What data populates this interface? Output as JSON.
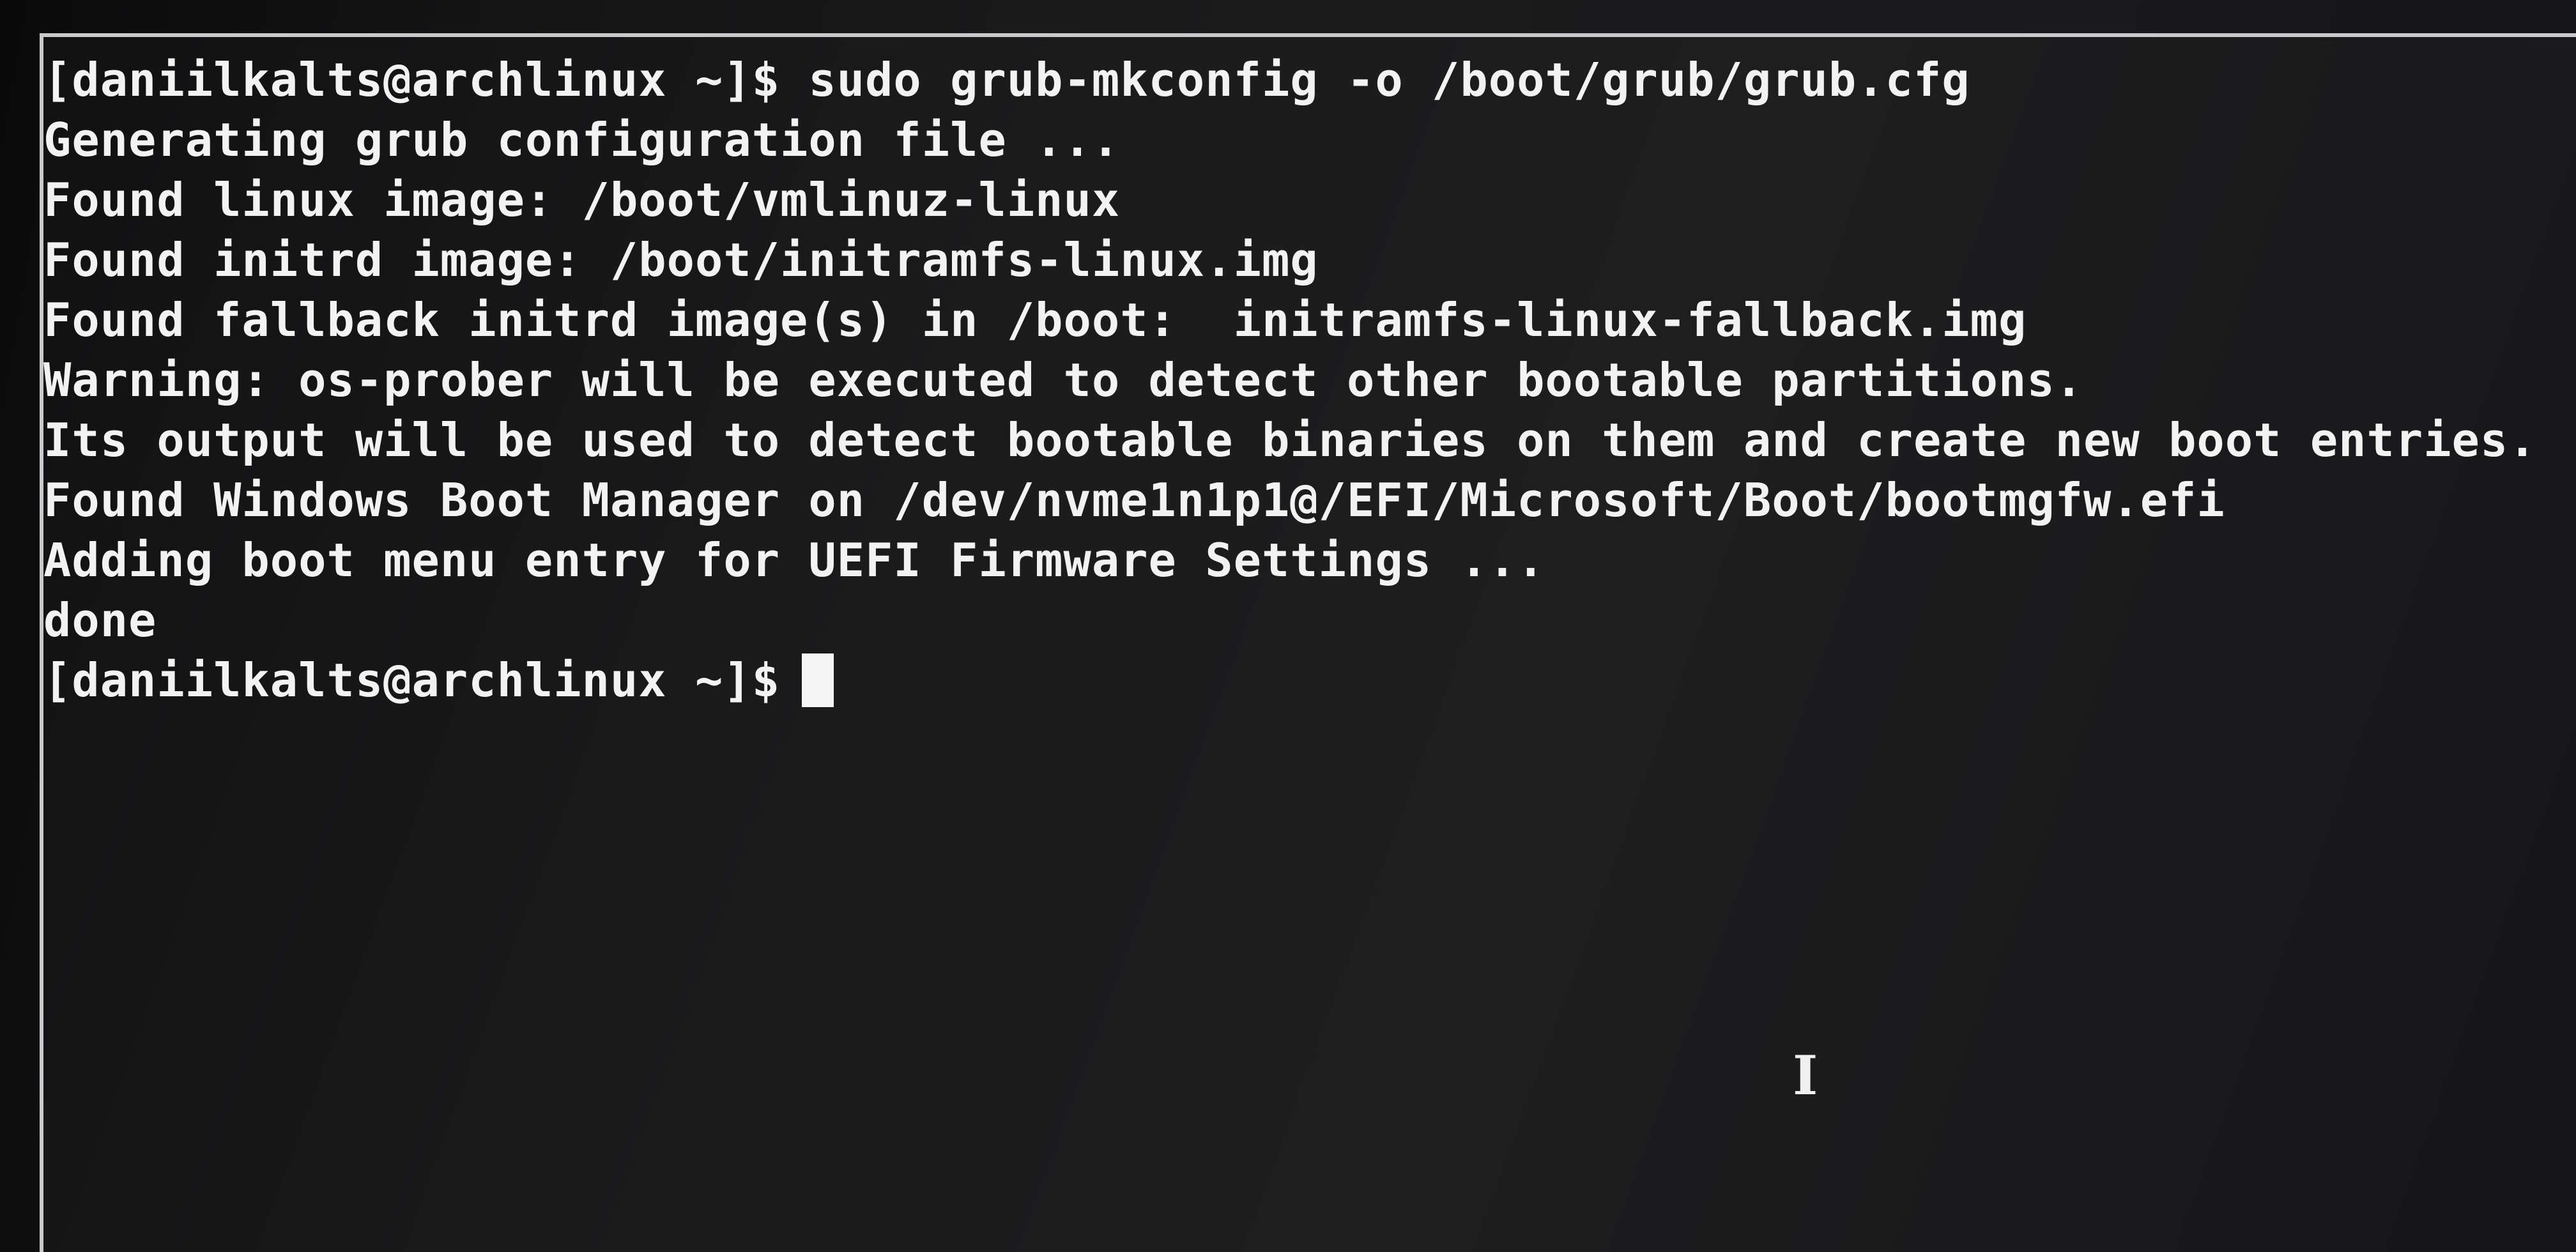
{
  "terminal": {
    "lines": [
      "[daniilkalts@archlinux ~]$ sudo grub-mkconfig -o /boot/grub/grub.cfg",
      "Generating grub configuration file ...",
      "Found linux image: /boot/vmlinuz-linux",
      "Found initrd image: /boot/initramfs-linux.img",
      "Found fallback initrd image(s) in /boot:  initramfs-linux-fallback.img",
      "Warning: os-prober will be executed to detect other bootable partitions.",
      "Its output will be used to detect bootable binaries on them and create new boot entries.",
      "Found Windows Boot Manager on /dev/nvme1n1p1@/EFI/Microsoft/Boot/bootmgfw.efi",
      "Adding boot menu entry for UEFI Firmware Settings ...",
      "done"
    ],
    "prompt": "[daniilkalts@archlinux ~]$",
    "mouse_cursor_glyph": "I"
  },
  "colors": {
    "text": "#f2f2f2",
    "background": "#1b1b1c",
    "border": "#c9c9cc"
  }
}
